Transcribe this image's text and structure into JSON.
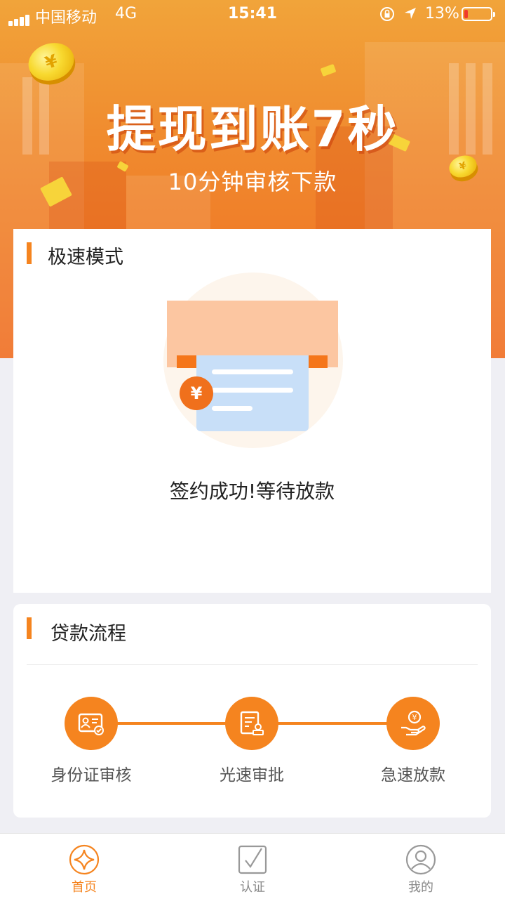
{
  "status_bar": {
    "carrier": "中国移动",
    "network": "4G",
    "time": "15:41",
    "battery_percent": "13%",
    "battery_level": 0.13,
    "battery_color": "#f03a2a"
  },
  "hero": {
    "title": "提现到账7秒",
    "subtitle": "10分钟审核下款",
    "coin_symbol": "¥"
  },
  "speed_mode": {
    "heading": "极速模式",
    "illustration_symbol": "¥",
    "message": "签约成功!等待放款"
  },
  "loan_process": {
    "heading": "贷款流程",
    "steps": [
      {
        "label": "身份证审核",
        "icon": "id-card-icon"
      },
      {
        "label": "光速审批",
        "icon": "approval-doc-icon"
      },
      {
        "label": "急速放款",
        "icon": "hand-money-icon"
      }
    ]
  },
  "tab_bar": {
    "tabs": [
      {
        "label": "首页",
        "icon": "home-star-icon",
        "active": true
      },
      {
        "label": "认证",
        "icon": "certify-check-icon",
        "active": false
      },
      {
        "label": "我的",
        "icon": "profile-icon",
        "active": false
      }
    ]
  },
  "colors": {
    "accent": "#f5841f",
    "hero_top": "#f1a43a",
    "hero_bottom": "#f06e22",
    "page_bg": "#efeff4"
  }
}
